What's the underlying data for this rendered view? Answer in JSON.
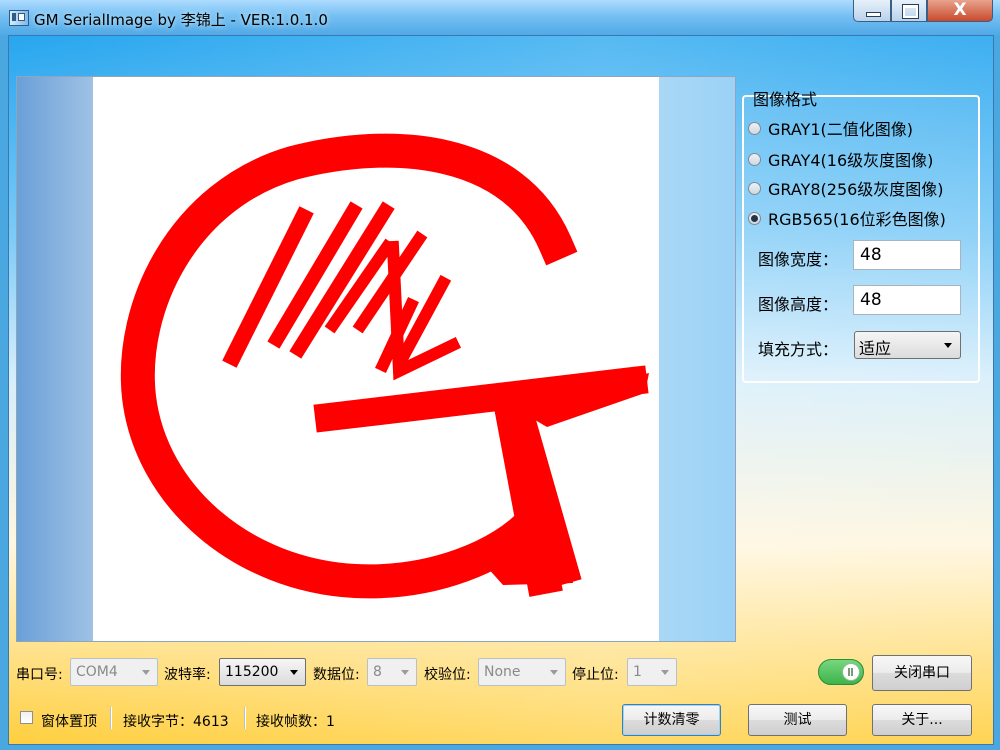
{
  "window": {
    "title": "GM SerialImage by 李锦上 - VER:1.0.1.0"
  },
  "title_controls": {
    "close_glyph": "X"
  },
  "image_format": {
    "group_title": "图像格式",
    "options": [
      {
        "label": "GRAY1(二值化图像)",
        "checked": false
      },
      {
        "label": "GRAY4(16级灰度图像)",
        "checked": false
      },
      {
        "label": "GRAY8(256级灰度图像)",
        "checked": false
      },
      {
        "label": "RGB565(16位彩色图像)",
        "checked": true
      }
    ],
    "width_label": "图像宽度：",
    "width_value": "48",
    "height_label": "图像高度：",
    "height_value": "48",
    "fill_label": "填充方式：",
    "fill_value": "适应"
  },
  "serial": {
    "port_label": "串口号:",
    "port_value": "COM4",
    "baud_label": "波特率:",
    "baud_value": "115200",
    "data_bits_label": "数据位:",
    "data_bits_value": "8",
    "parity_label": "校验位:",
    "parity_value": "None",
    "stop_bits_label": "停止位:",
    "stop_bits_value": "1",
    "connected_toggle_on": true,
    "close_port_label": "关闭串口"
  },
  "status": {
    "topmost_label": "窗体置顶",
    "topmost_checked": false,
    "bytes_received": "接收字节：4613",
    "frames_received": "接收帧数：1"
  },
  "buttons": {
    "clear_count": "计数清零",
    "test": "测试",
    "about": "关于..."
  },
  "preview": {
    "icon": "red-g-logo-image",
    "colors": {
      "fg": "#ff0000",
      "bg": "#ffffff"
    }
  }
}
